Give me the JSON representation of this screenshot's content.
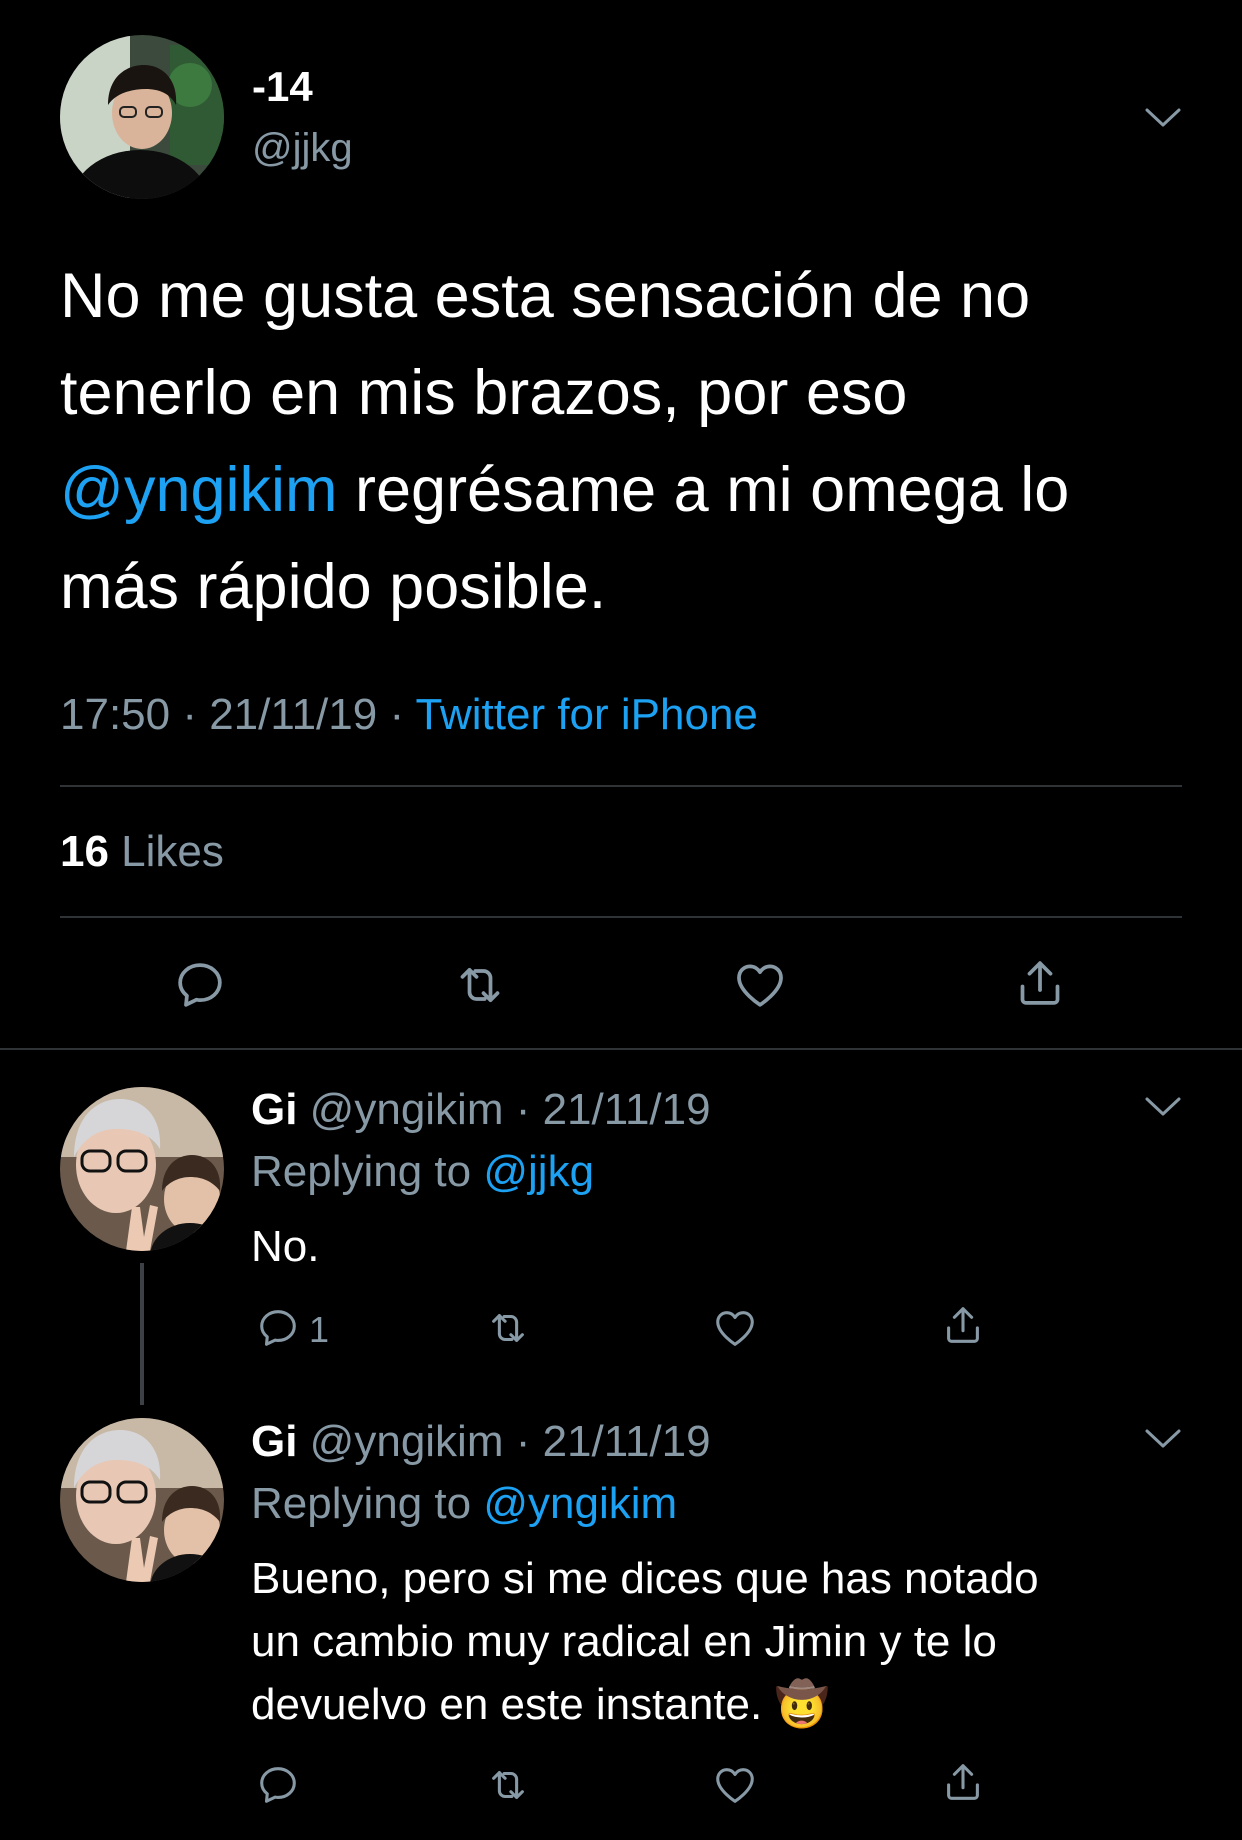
{
  "main_tweet": {
    "display_name": "-14",
    "handle": "@jjkg",
    "text_lines": [
      "No me gusta esta sensación de no",
      "tenerlo en mis brazos, por eso",
      "regrésame a mi omega lo",
      "más rápido posible."
    ],
    "mention": "@yngikim",
    "time": "17:50 · 21/11/19 · ",
    "source": "Twitter for iPhone",
    "likes_count": "16",
    "likes_label": " Likes"
  },
  "replies": [
    {
      "display_name": "Gi",
      "handle_date": " @yngikim · 21/11/19",
      "replying_label": "Replying to ",
      "replying_to": "@jjkg",
      "text_lines": [
        "No."
      ],
      "reply_count": "1"
    },
    {
      "display_name": "Gi",
      "handle_date": " @yngikim · 21/11/19",
      "replying_label": "Replying to ",
      "replying_to": "@yngikim",
      "text_lines": [
        "Bueno, pero si me dices que has notado",
        "un cambio muy radical en Jimin y te lo",
        "devuelvo en este instante. 🤠"
      ]
    }
  ],
  "icons": [
    "chevron-down-icon",
    "reply-icon",
    "retweet-icon",
    "like-icon",
    "share-icon"
  ],
  "colors": {
    "background": "#000000",
    "accent": "#1da1f2",
    "secondary_text": "#8899a6",
    "divider": "#2f3336"
  }
}
